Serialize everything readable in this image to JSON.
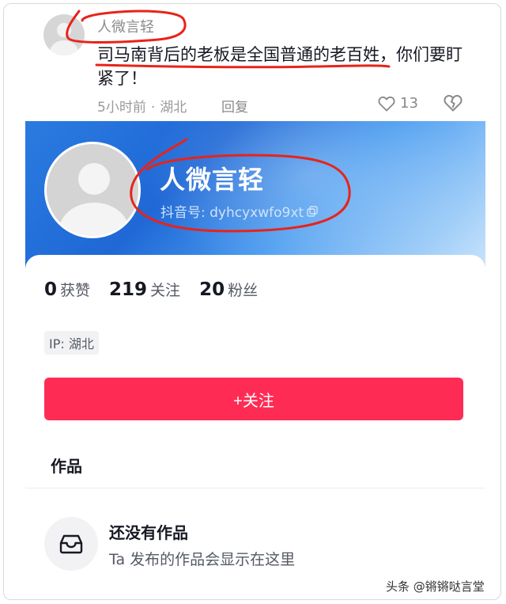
{
  "comment": {
    "username": "人微言轻",
    "text": "司马南背后的老板是全国普通的老百姓，你们要盯紧了！",
    "time": "5小时前",
    "separator": "·",
    "location": "湖北",
    "reply_label": "回复",
    "like_count": "13",
    "icons": [
      "avatar-placeholder",
      "heart-icon",
      "broken-heart-icon"
    ]
  },
  "profile": {
    "name": "人微言轻",
    "douyin_id": "抖音号: dyhcyxwfo9xt",
    "stats": [
      {
        "value": "0",
        "label": "获赞"
      },
      {
        "value": "219",
        "label": "关注"
      },
      {
        "value": "20",
        "label": "粉丝"
      }
    ],
    "ip_label": "IP: 湖北",
    "follow_button": "+关注",
    "banner_color": "#1f68d6",
    "accent_color": "#fe2c55"
  },
  "works": {
    "title": "作品",
    "empty_title": "还没有作品",
    "empty_subtitle": "Ta 发布的作品会显示在这里",
    "empty_icon": "inbox-icon"
  },
  "watermark": "头条 @锵锵哒言堂"
}
